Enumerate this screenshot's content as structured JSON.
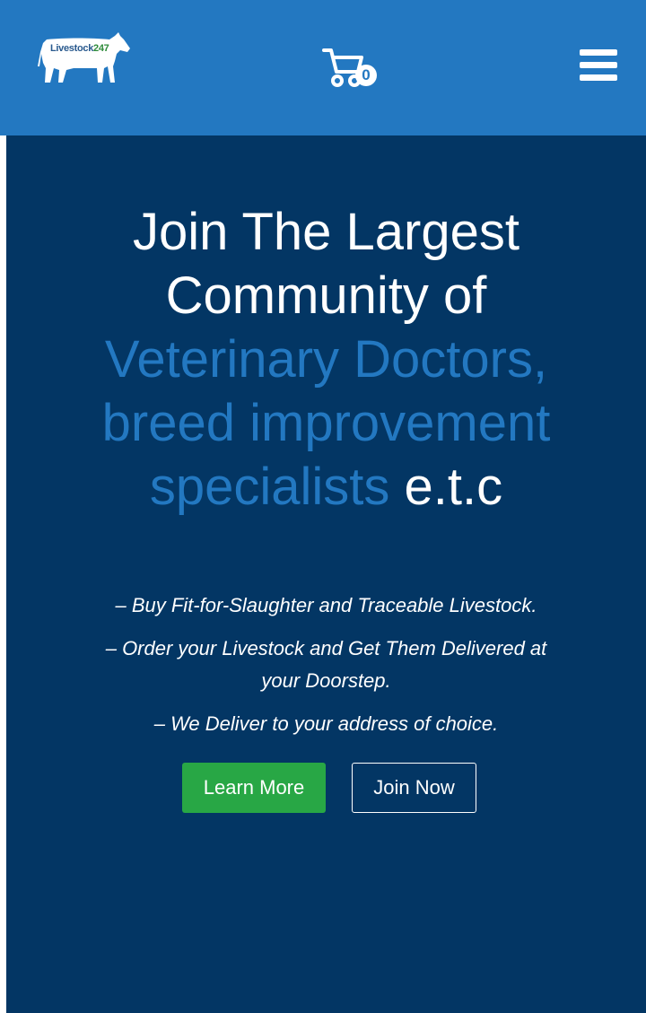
{
  "header": {
    "logo": {
      "text": "Livestock",
      "number": "247",
      "icon": "cow-logo-icon"
    },
    "cart": {
      "count": "0",
      "icon": "cart-icon"
    },
    "menu": {
      "icon": "hamburger-menu-icon"
    }
  },
  "hero": {
    "headline": {
      "line1": "Join The Largest",
      "line2": "Community of",
      "line3": "Veterinary Doctors,",
      "line4": "breed improvement",
      "line5_accent": "specialists",
      "line5_rest": "e.t.c"
    },
    "bullets": [
      "– Buy Fit-for-Slaughter and Traceable Livestock.",
      "– Order your Livestock and Get Them Delivered at your Doorstep.",
      "– We Deliver to your address of choice."
    ],
    "buttons": {
      "learn_more": "Learn More",
      "join_now": "Join Now"
    }
  },
  "colors": {
    "header_bg": "#2378c1",
    "hero_bg": "#033664",
    "accent": "#2378c1",
    "learn_button": "#28a745",
    "text": "#ffffff"
  }
}
